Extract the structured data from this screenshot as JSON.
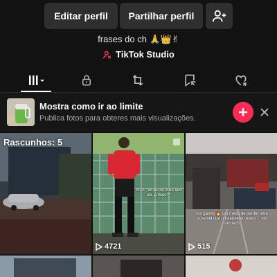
{
  "profile_actions": {
    "edit_label": "Editar perfil",
    "share_label": "Partilhar perfil",
    "add_friend_icon": "person-plus-icon"
  },
  "bio": {
    "text": "frases do ch 🙏👑✌",
    "studio_label": "TikTok Studio"
  },
  "tabs": [
    {
      "name": "videos-grid",
      "icon": "grid-icon",
      "active": true
    },
    {
      "name": "private",
      "icon": "lock-icon"
    },
    {
      "name": "reposts",
      "icon": "repost-icon"
    },
    {
      "name": "favorites",
      "icon": "bookmark-icon"
    },
    {
      "name": "liked",
      "icon": "heart-icon"
    }
  ],
  "promo": {
    "title": "Mostra como ir ao limite",
    "subtitle": "Publica fotos para obteres mais visualizações."
  },
  "grid": {
    "drafts_label": "Rascunhos: 5",
    "videos": [
      {
        "views": "4721",
        "caption": "POV: \"vc viu os mlks que ela já ficou?\""
      },
      {
        "views": "515",
        "caption": "um garoto 🔥 um medo de perder uma possível que o tratamento estes ... em um tech"
      }
    ]
  },
  "colors": {
    "background": "#121212",
    "button_bg": "#2f2f2f",
    "accent": "#fe2c55"
  }
}
